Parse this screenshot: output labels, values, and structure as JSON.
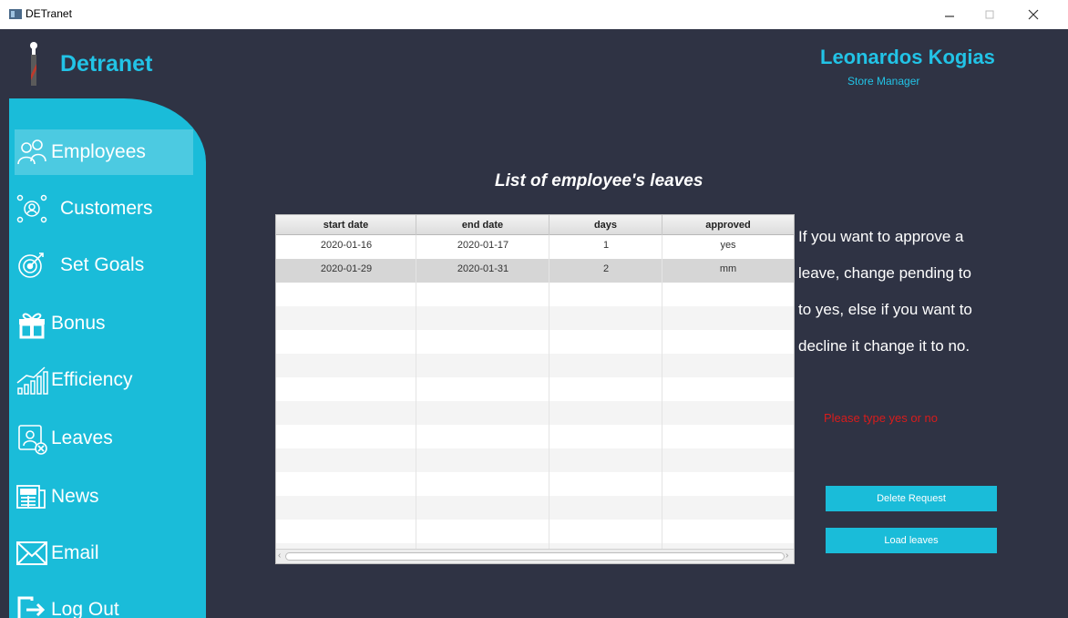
{
  "window": {
    "title": "DETranet",
    "controls": {
      "minimize": "–",
      "maximize": "□",
      "close": "×"
    }
  },
  "brand": {
    "name": "Detranet"
  },
  "user": {
    "name": "Leonardos Kogias",
    "role": "Store Manager"
  },
  "sidebar": {
    "items": [
      {
        "label": "Employees",
        "icon": "employees-icon",
        "active": true
      },
      {
        "label": "Customers",
        "icon": "customers-icon"
      },
      {
        "label": "Set Goals",
        "icon": "target-icon"
      },
      {
        "label": "Bonus",
        "icon": "gift-icon"
      },
      {
        "label": "Efficiency",
        "icon": "efficiency-chart-icon"
      },
      {
        "label": "Leaves",
        "icon": "leaves-icon"
      },
      {
        "label": "News",
        "icon": "news-icon"
      },
      {
        "label": "Email",
        "icon": "email-icon"
      },
      {
        "label": "Log Out",
        "icon": "logout-icon"
      }
    ]
  },
  "main": {
    "title": "List of employee's leaves",
    "table": {
      "columns": [
        "start date",
        "end date",
        "days",
        "approved"
      ],
      "rows": [
        [
          "2020-01-16",
          "2020-01-17",
          "1",
          "yes"
        ],
        [
          "2020-01-29",
          "2020-01-31",
          "2",
          "mm"
        ]
      ]
    }
  },
  "instructions": {
    "lines": [
      "If you want to approve a",
      "leave, change pending to",
      "to yes, else if you want to",
      "decline it change it to no."
    ],
    "error": "Please type yes or no"
  },
  "buttons": {
    "delete": "Delete Request",
    "load": "Load leaves"
  },
  "colors": {
    "accent": "#1abcd9",
    "background": "#2f3344",
    "error": "#d81c1c"
  }
}
